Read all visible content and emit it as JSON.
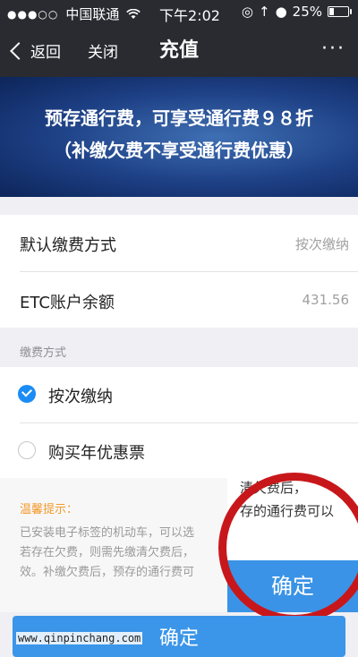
{
  "status_bar": {
    "carrier": "中国联通",
    "signal_dots": "●●●○○",
    "time": "下午2:02",
    "battery": "25%",
    "battery_level": 0.25
  },
  "nav": {
    "back_label": "返回",
    "close_label": "关闭",
    "title": "充值",
    "more_label": "···"
  },
  "banner": {
    "line1": "预存通行费，可享受通行费９８折",
    "line2": "（补缴欠费不享受通行费优惠）"
  },
  "info_rows": [
    {
      "label": "默认缴费方式",
      "value": "按次缴纳"
    },
    {
      "label": "ETC账户余额",
      "value": "431.56"
    }
  ],
  "payment_section": {
    "caption": "缴费方式",
    "options": [
      {
        "label": "按次缴纳",
        "selected": true
      },
      {
        "label": "购买年优惠票",
        "selected": false
      }
    ]
  },
  "tips": {
    "title": "温馨提示：",
    "lines": [
      "已安装电子标签的机动车，可以选",
      "若存在欠费，则需先缴清欠费后，",
      "效。补缴欠费后，预存的通行费可"
    ]
  },
  "callout": {
    "line1": "清欠费后，",
    "line2": "存的通行费可以",
    "button_label": "确定"
  },
  "confirm_button": {
    "label": "确定"
  },
  "watermark": "www.qinpinchang.com",
  "colors": {
    "accent": "#3b95e8",
    "tips_title": "#f39a2b",
    "highlight_ring": "#c8171b"
  }
}
